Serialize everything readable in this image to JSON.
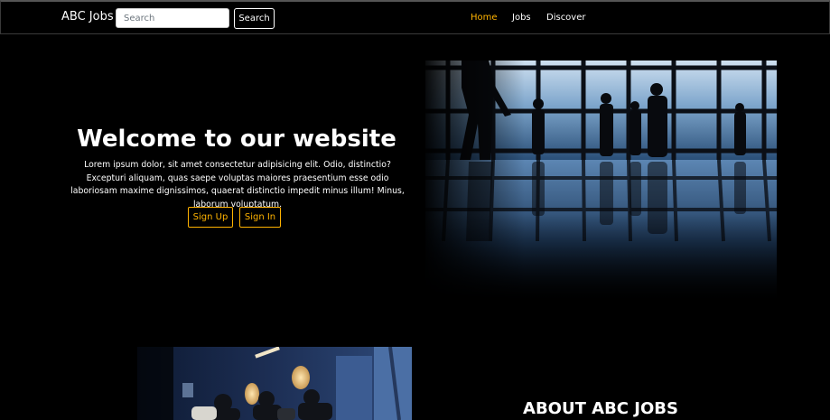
{
  "navbar": {
    "brand": "ABC Jobs",
    "search": {
      "placeholder": "Search",
      "value": ""
    },
    "search_button": "Search",
    "links": [
      {
        "label": "Home",
        "active": true
      },
      {
        "label": "Jobs",
        "active": false
      },
      {
        "label": "Discover",
        "active": false
      }
    ]
  },
  "hero": {
    "title": "Welcome to our website",
    "text": "Lorem ipsum dolor, sit amet consectetur adipisicing elit. Odio, distinctio? Excepturi aliquam, quas saepe voluptas maiores praesentium esse odio laboriosam maxime dignissimos, quaerat distinctio impedit minus illum! Minus, laborum voluptatum.",
    "buttons": {
      "sign_up": "Sign Up",
      "sign_in": "Sign In"
    }
  },
  "about": {
    "title": "ABOUT ABC JOBS"
  },
  "colors": {
    "background": "#000000",
    "accent": "#ffb300",
    "text": "#ffffff"
  }
}
